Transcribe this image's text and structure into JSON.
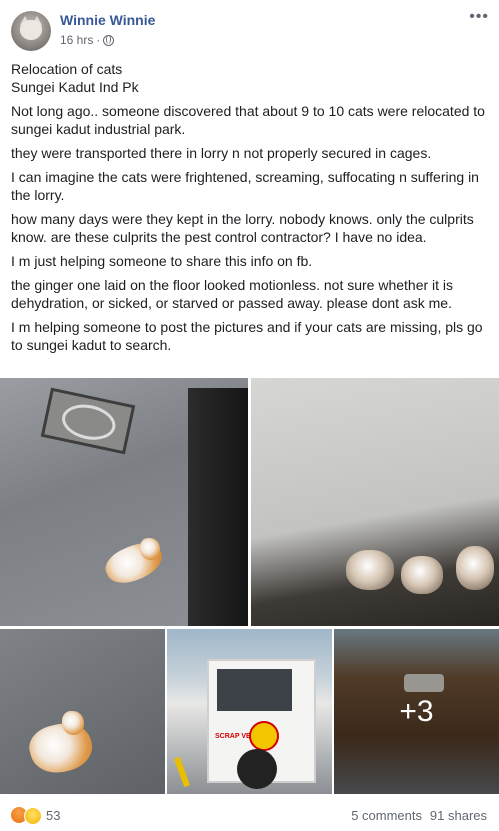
{
  "header": {
    "author": "Winnie Winnie",
    "timestamp": "16 hrs",
    "separator": "·",
    "more_label": "•••"
  },
  "post": {
    "title_line_1": "Relocation of cats",
    "title_line_2": "Sungei Kadut Ind Pk",
    "paragraphs": [
      "Not long ago.. someone discovered that about 9 to 10 cats were relocated to sungei kadut industrial park.",
      "they were transported there in lorry n not properly secured in cages.",
      "I can imagine the cats were frightened, screaming, suffocating n suffering in the lorry.",
      "how many days were they kept in the lorry. nobody knows. only the culprits know. are these culprits the pest control contractor? I have no idea.",
      "I m just helping someone to share this info on fb.",
      "the ginger one laid on the floor looked motionless. not sure whether it is dehydration, or sicked, or starved or passed away. please dont ask me.",
      "I m helping someone to post the pictures and if your cats are missing, pls go to sungei kadut to search."
    ]
  },
  "photos": {
    "more_count": "+3",
    "truck_text": "SCRAP VEHICLES"
  },
  "footer": {
    "reaction_count": "53",
    "comments": "5 comments",
    "shares": "91 shares"
  },
  "icons": {
    "globe": "globe-icon",
    "more": "more-options-icon",
    "angry": "angry-reaction-icon",
    "sad": "sad-reaction-icon"
  }
}
